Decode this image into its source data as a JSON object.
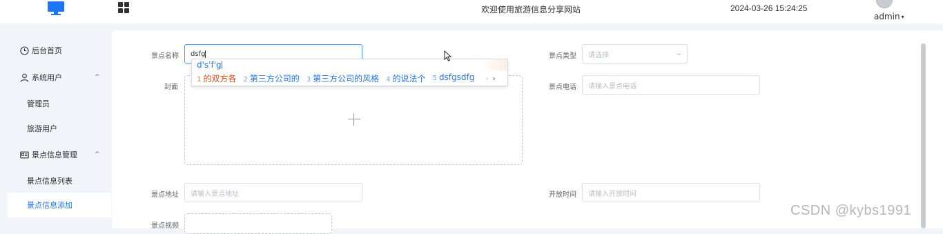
{
  "header": {
    "site_title": "欢迎使用旅游信息分享网站",
    "datetime": "2024-03-26 15:24:25",
    "user": "admin"
  },
  "sidebar": {
    "items": [
      {
        "label": "后台首页",
        "icon": "clock-icon"
      },
      {
        "label": "系统用户",
        "icon": "user-icon",
        "arrow": "^"
      },
      {
        "label": "管理员"
      },
      {
        "label": "旅游用户"
      },
      {
        "label": "景点信息管理",
        "icon": "id-card-icon",
        "arrow": "^"
      },
      {
        "label": "景点信息列表"
      },
      {
        "label": "景点信息添加"
      }
    ]
  },
  "form": {
    "name_label": "景点名称",
    "name_value": "dsfg",
    "type_label": "景点类型",
    "type_placeholder": "请选择",
    "cover_label": "封面",
    "phone_label": "景点电话",
    "phone_placeholder": "请输入景点电话",
    "address_label": "景点地址",
    "address_placeholder": "请输入景点地址",
    "open_time_label": "开放时间",
    "open_time_placeholder": "请输入开放时间",
    "video_label": "景点视频"
  },
  "ime": {
    "composition": "d's'f'g",
    "candidates": [
      {
        "num": "1",
        "text": "的双方各"
      },
      {
        "num": "2",
        "text": "第三方公司的"
      },
      {
        "num": "3",
        "text": "第三方公司的风格"
      },
      {
        "num": "4",
        "text": "的说法个"
      },
      {
        "num": "5",
        "text": "dsfgsdfg"
      }
    ],
    "prev": "‹",
    "next": "›"
  },
  "watermark": "CSDN @kybs1991",
  "colors": {
    "accent": "#1e76f5",
    "ime_selected": "#e8470f",
    "background": "#f1f4f9"
  }
}
